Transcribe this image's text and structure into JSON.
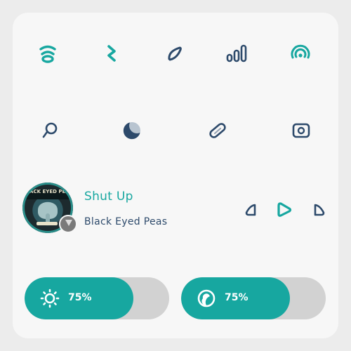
{
  "quick_tiles_row1": [
    {
      "name": "wifi-tile",
      "icon": "wifi-icon",
      "active": true
    },
    {
      "name": "bluetooth-tile",
      "icon": "bluetooth-icon",
      "active": true
    },
    {
      "name": "airplane-mode-tile",
      "icon": "airplane-icon",
      "active": false
    },
    {
      "name": "mobile-data-tile",
      "icon": "signal-icon",
      "active": false
    },
    {
      "name": "hotspot-tile",
      "icon": "hotspot-icon",
      "active": true
    }
  ],
  "quick_tiles_row2": [
    {
      "name": "flashlight-tile",
      "icon": "flashlight-icon",
      "active": false
    },
    {
      "name": "dark-mode-tile",
      "icon": "dark-mode-icon",
      "active": false
    },
    {
      "name": "battery-saver-tile",
      "icon": "battery-saver-icon",
      "active": false
    },
    {
      "name": "screenshot-tile",
      "icon": "screenshot-icon",
      "active": false
    }
  ],
  "media": {
    "title": "Shut Up",
    "artist": "Black Eyed Peas",
    "album_art_text": "BLACK EYED PEAS",
    "controls": [
      "previous-icon",
      "play-icon",
      "next-icon"
    ]
  },
  "brightness": {
    "label": "75%",
    "level": 0.75,
    "icon": "sun-icon"
  },
  "volume": {
    "label": "75%",
    "level": 0.75,
    "icon": "volume-ring-icon"
  },
  "colors": {
    "accent": "#17a7a0",
    "icon_dark": "#2d4a6b",
    "track": "#d2d2d2",
    "background": "#f7f7f7"
  }
}
